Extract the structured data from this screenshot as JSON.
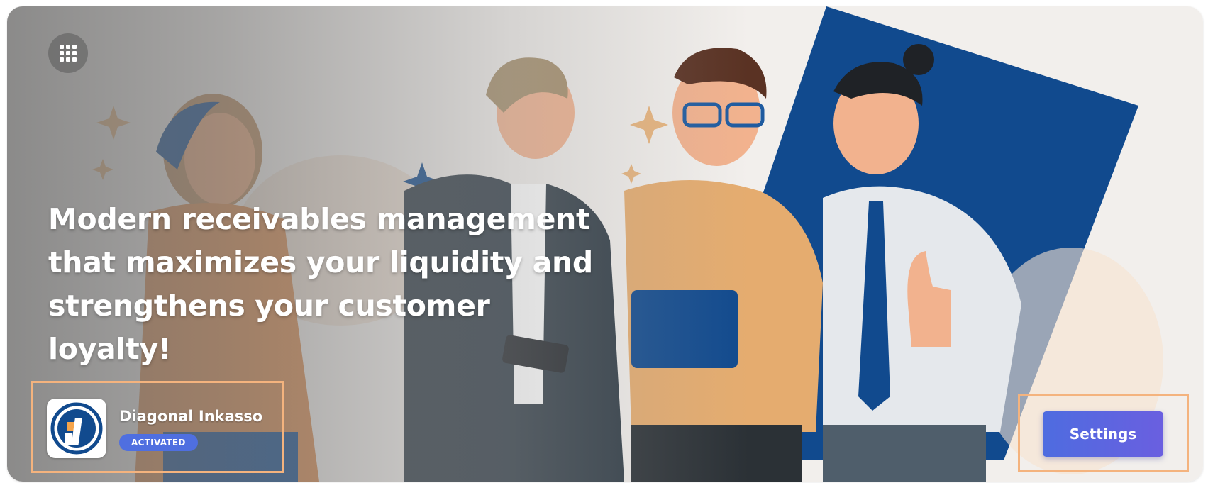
{
  "banner": {
    "headline": "Modern receivables management that maximizes your liquidity and strengthens your customer loyalty!",
    "menu_icon": "grid-icon"
  },
  "app": {
    "name": "Diagonal Inkasso",
    "status": "ACTIVATED",
    "logo_icon": "diagonal-inkasso-logo"
  },
  "actions": {
    "settings_label": "Settings"
  },
  "colors": {
    "accent": "#5b66e0",
    "badge": "#4f6fe0",
    "highlight": "#f4b37e",
    "navy": "#114a8e"
  }
}
